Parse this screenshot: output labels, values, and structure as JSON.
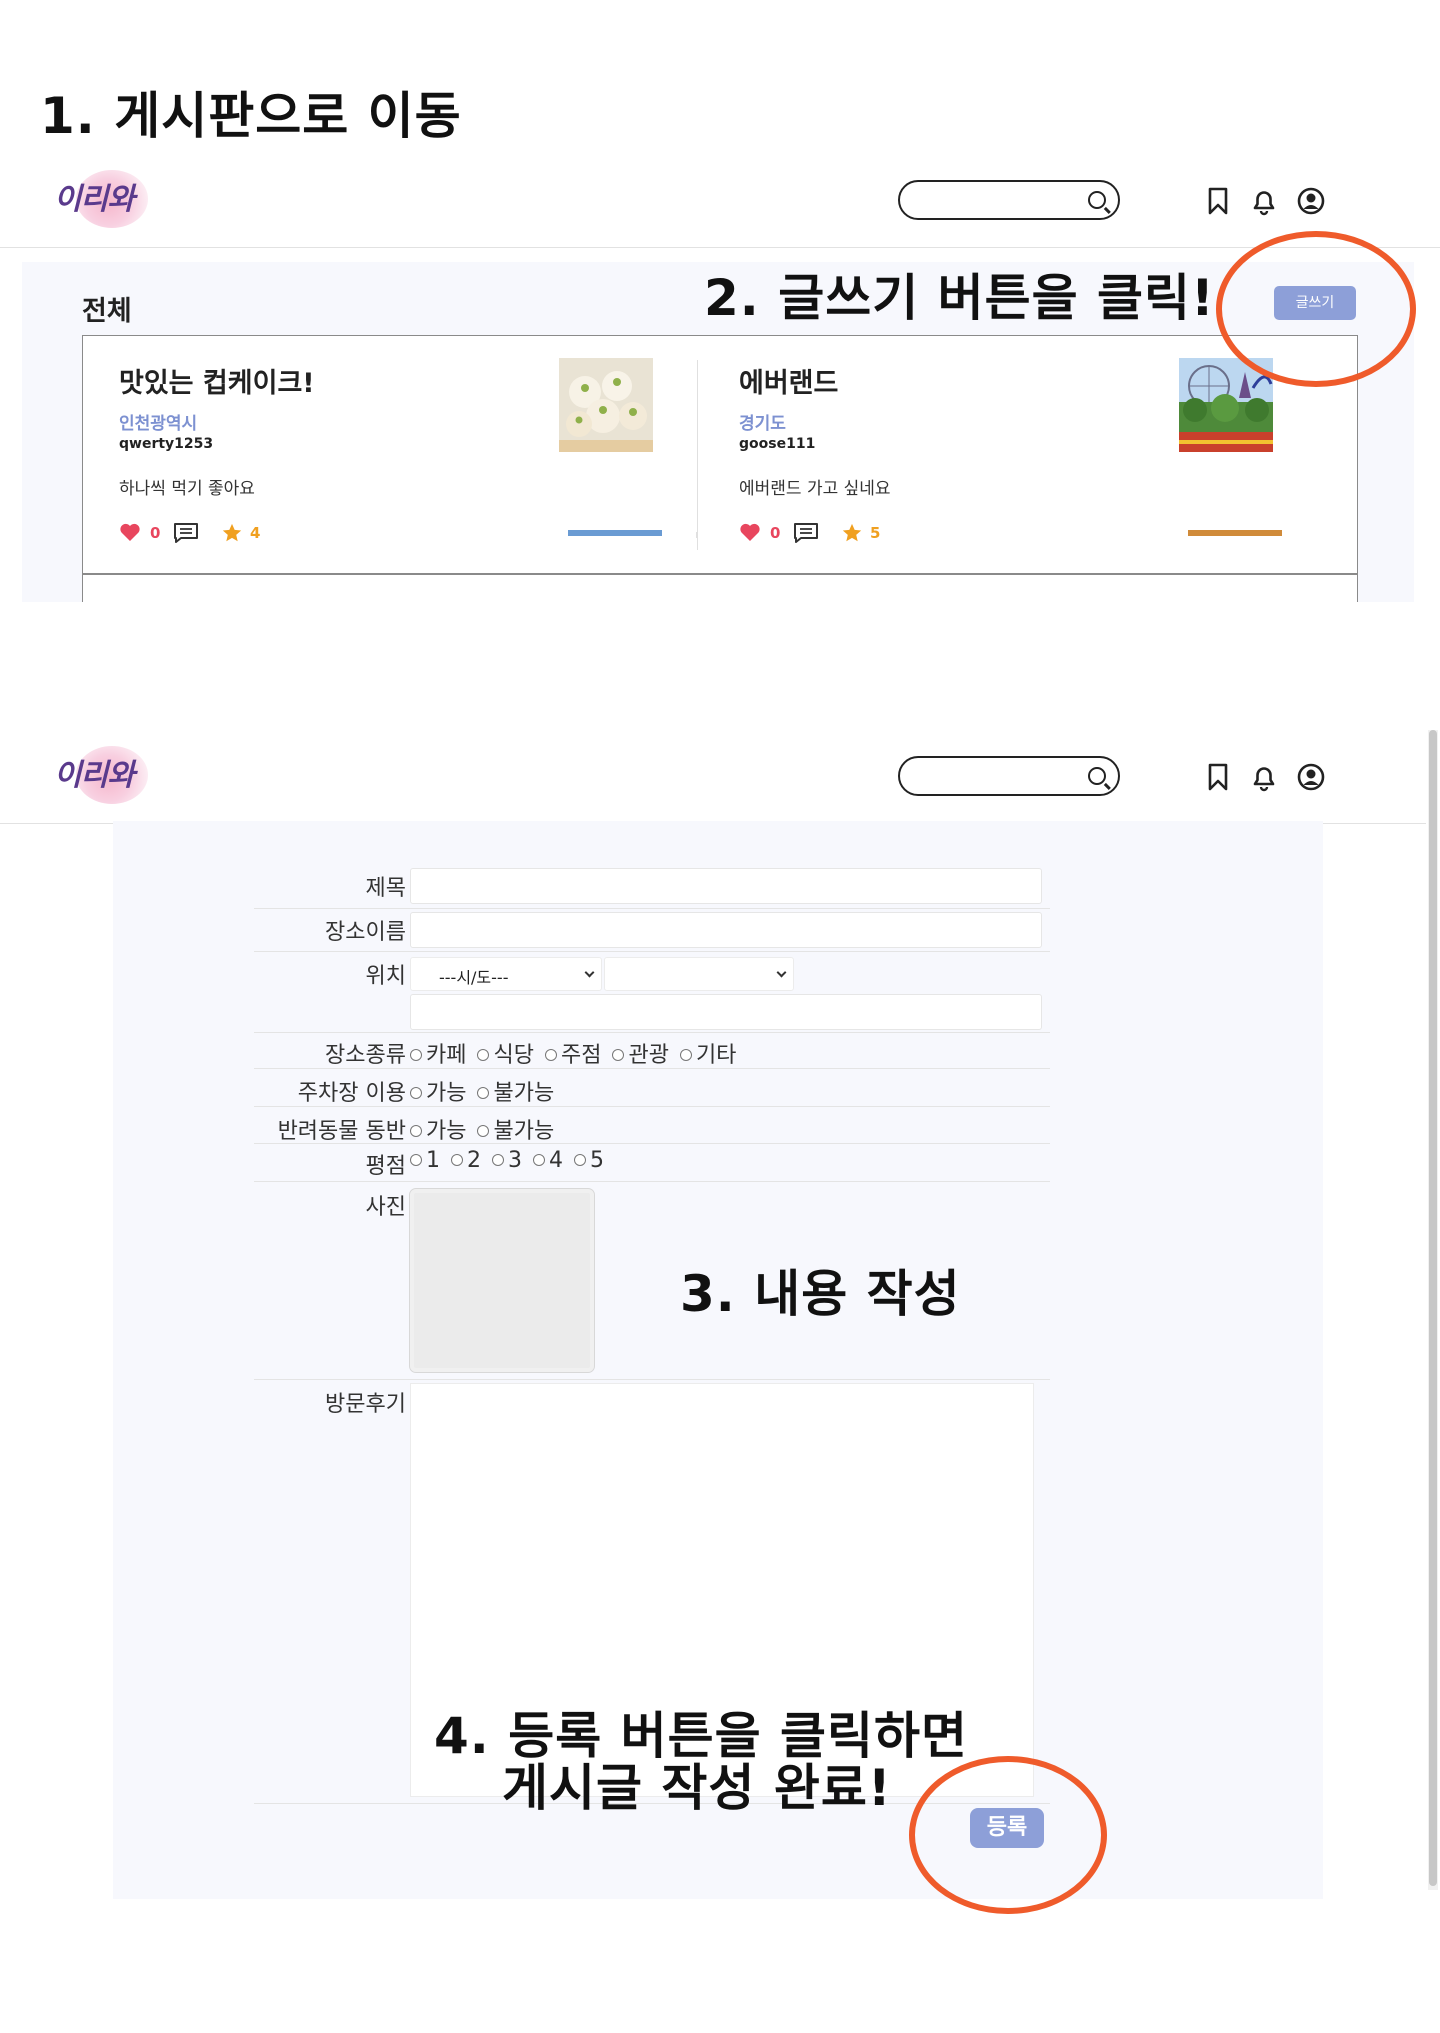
{
  "steps": {
    "step1": "1. 게시판으로 이동",
    "step2": "2. 글쓰기 버튼을 클릭!",
    "step3": "3. 내용 작성",
    "step4_line1": "4. 등록 버튼을 클릭하면",
    "step4_line2": "게시글 작성 완료!"
  },
  "header": {
    "logo_text": "이리와",
    "icons": [
      "bookmark-icon",
      "bell-icon",
      "user-icon"
    ]
  },
  "board": {
    "title": "전체",
    "write_button": "글쓰기",
    "cards": [
      {
        "title": "맛있는 컵케이크!",
        "region": "인천광역시",
        "user": "qwerty1253",
        "body": "하나씩 먹기 좋아요",
        "likes": "0",
        "rating": "4"
      },
      {
        "title": "에버랜드",
        "region": "경기도",
        "user": "goose111",
        "body": "에버랜드 가고 싶네요",
        "likes": "0",
        "rating": "5"
      }
    ]
  },
  "form": {
    "labels": {
      "title": "제목",
      "place_name": "장소이름",
      "location": "위치",
      "place_type": "장소종류",
      "parking": "주차장 이용",
      "pet": "반려동물 동반",
      "rating": "평점",
      "photo": "사진",
      "review": "방문후기"
    },
    "province_select": "---시/도---",
    "place_type_options": [
      "카페",
      "식당",
      "주점",
      "관광",
      "기타"
    ],
    "parking_options": [
      "가능",
      "불가능"
    ],
    "pet_options": [
      "가능",
      "불가능"
    ],
    "rating_options": [
      "1",
      "2",
      "3",
      "4",
      "5"
    ],
    "submit_button": "등록"
  },
  "colors": {
    "accent_button": "#8d9fd8",
    "annotation_circle": "#ef5b2b",
    "region_text": "#7d91d1",
    "heart": "#e8465e",
    "star": "#f0a020"
  }
}
